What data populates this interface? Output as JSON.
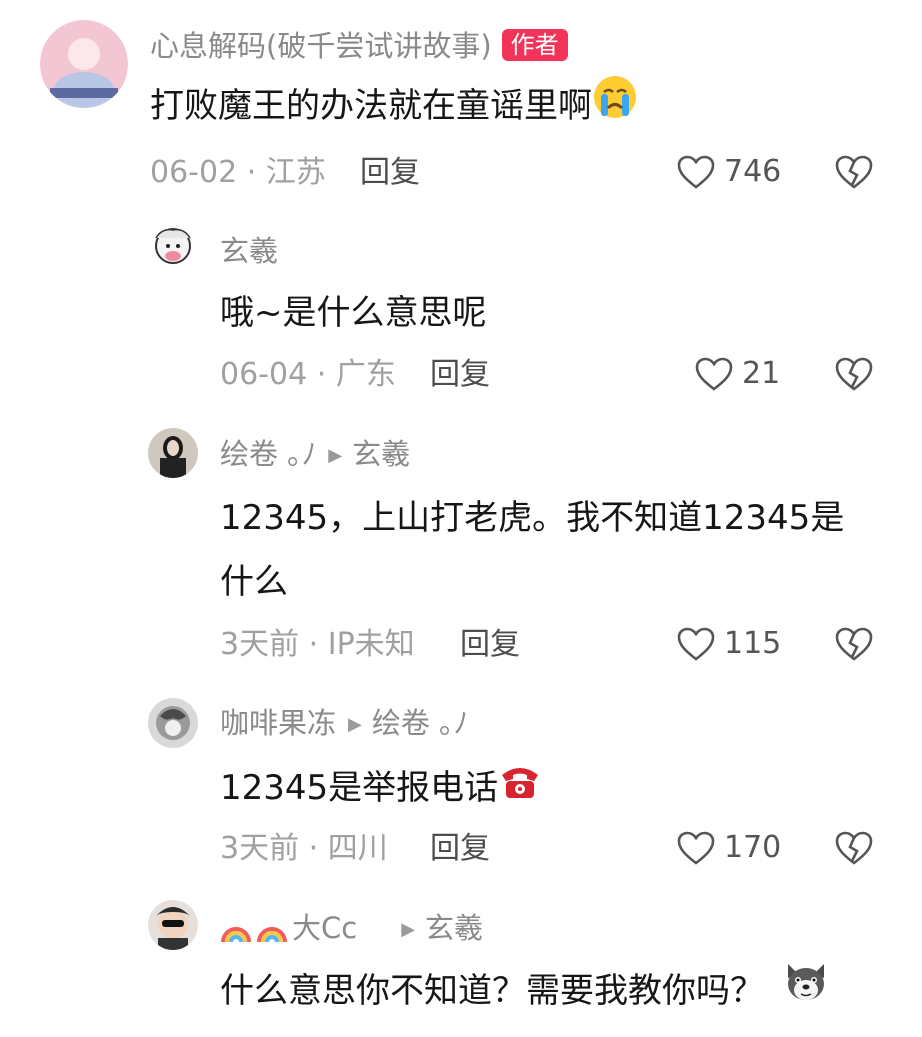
{
  "comments": [
    {
      "user": "心息解码(破千尝试讲故事)",
      "badge": "作者",
      "text": "打败魔王的办法就在童谣里啊",
      "emoji": "crying-face",
      "date": "06-02",
      "location": "江苏",
      "reply_label": "回复",
      "likes": "746"
    },
    {
      "user": "玄羲",
      "text": "哦~是什么意思呢",
      "date": "06-04",
      "location": "广东",
      "reply_label": "回复",
      "likes": "21"
    },
    {
      "user": "绘卷",
      "reply_to": "玄羲",
      "text_line1": "12345，上山打老虎。我不知道12345是",
      "text_line2": "什么",
      "date": "3天前",
      "location": "IP未知",
      "reply_label": "回复",
      "likes": "115"
    },
    {
      "user": "咖啡果冻",
      "reply_to": "绘卷",
      "text": "12345是举报电话",
      "emoji": "telephone",
      "date": "3天前",
      "location": "四川",
      "reply_label": "回复",
      "likes": "170"
    },
    {
      "user": "大Cc",
      "user_prefix_icons": [
        "rainbow",
        "rainbow"
      ],
      "reply_to": "玄羲",
      "text": "什么意思你不知道？需要我教你吗？",
      "emoji": "dog-face"
    }
  ],
  "meta_separator": "·",
  "colors": {
    "badge": "#f2345a",
    "meta": "#a0a0a0",
    "username": "#8a8a8a"
  }
}
